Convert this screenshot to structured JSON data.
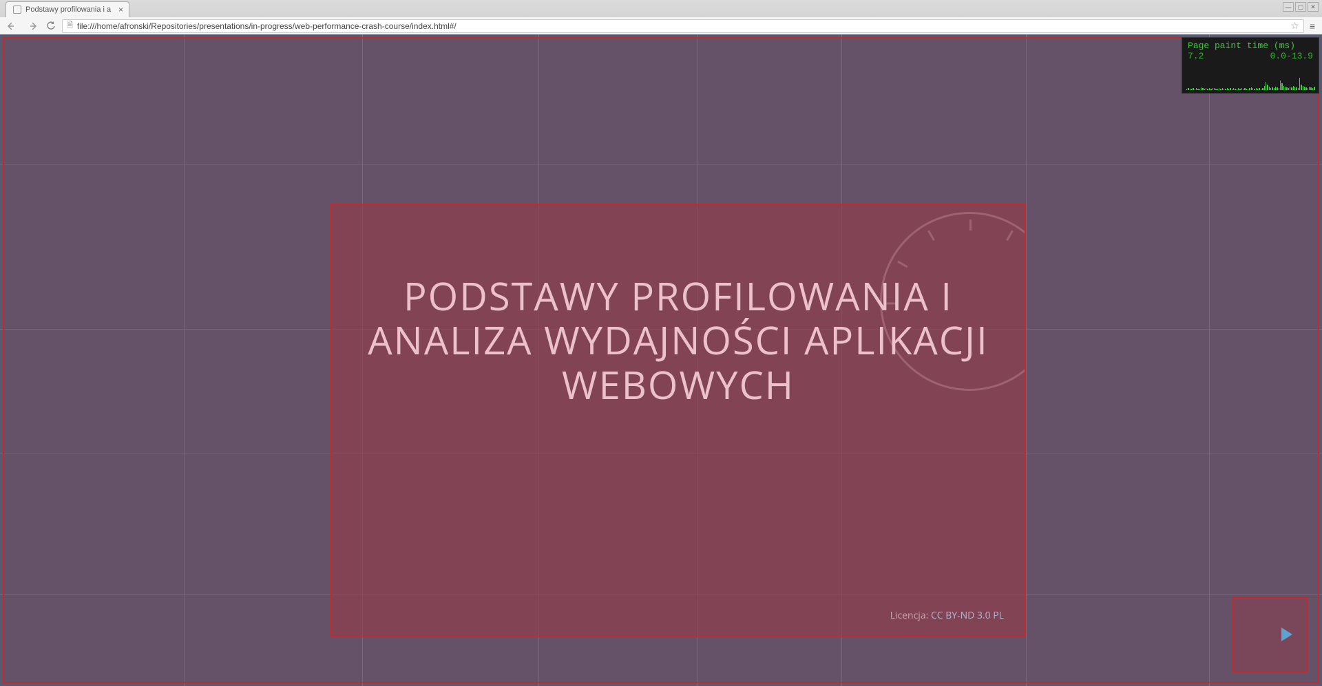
{
  "browser": {
    "tab_title": "Podstawy profilowania i a",
    "url": "file:///home/afronski/Repositories/presentations/in-progress/web-performance-crash-course/index.html#/"
  },
  "slide": {
    "title": "PODSTAWY PROFILOWANIA I ANALIZA WYDAJNOŚCI APLIKACJI WEBOWYCH",
    "license_label": "Licencja:",
    "license_link": "CC BY-ND 3.0 PL"
  },
  "paint": {
    "header": "Page paint time (ms)",
    "current": "7.2",
    "range": "0.0-13.9",
    "bars": [
      2,
      3,
      2,
      2,
      3,
      2,
      3,
      2,
      2,
      4,
      3,
      2,
      3,
      2,
      3,
      2,
      3,
      3,
      2,
      2,
      3,
      2,
      3,
      2,
      2,
      3,
      2,
      3,
      2,
      3,
      2,
      2,
      3,
      2,
      3,
      2,
      3,
      2,
      2,
      3,
      4,
      3,
      2,
      3,
      2,
      3,
      2,
      3,
      6,
      12,
      8,
      5,
      3,
      4,
      3,
      5,
      4,
      3,
      14,
      10,
      6,
      5,
      4,
      3,
      5,
      4,
      6,
      5,
      4,
      3,
      18,
      8,
      6,
      5,
      4,
      3,
      5,
      4,
      3,
      5
    ]
  },
  "grid": {
    "v_positions": [
      268,
      526,
      782,
      1012,
      1222,
      1490,
      1756
    ],
    "h_positions": [
      188,
      428,
      608,
      814
    ]
  }
}
